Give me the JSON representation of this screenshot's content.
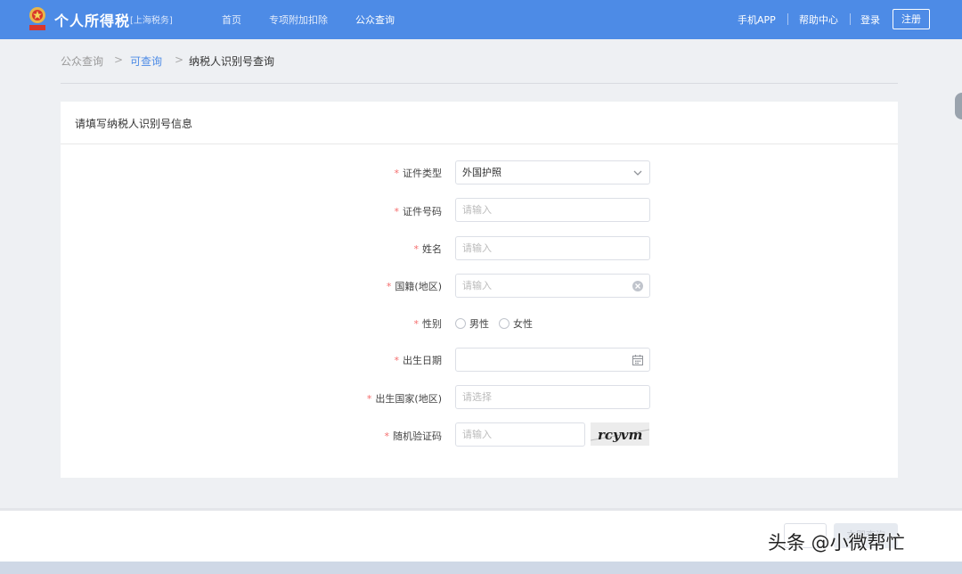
{
  "header": {
    "brand": "个人所得税",
    "region": "[上海税务]",
    "nav": [
      "首页",
      "专项附加扣除",
      "公众查询"
    ],
    "active_nav": "公众查询",
    "links": [
      "手机APP",
      "帮助中心",
      "登录"
    ],
    "register": "注册",
    "colors": {
      "bar": "#4d8be6"
    }
  },
  "breadcrumb": {
    "items": [
      "公众查询",
      "可查询",
      "纳税人识别号查询"
    ],
    "separator": ">"
  },
  "form": {
    "title": "请填写纳税人识别号信息",
    "required_mark": "*",
    "id_type": {
      "label": "证件类型",
      "value": "外国护照"
    },
    "id_number": {
      "label": "证件号码",
      "placeholder": "请输入"
    },
    "name": {
      "label": "姓名",
      "placeholder": "请输入"
    },
    "nationality": {
      "label": "国籍(地区)",
      "placeholder": "请输入"
    },
    "gender": {
      "label": "性别",
      "options": [
        "男性",
        "女性"
      ]
    },
    "birth_date": {
      "label": "出生日期"
    },
    "birth_country": {
      "label": "出生国家(地区)",
      "placeholder": "请选择"
    },
    "captcha": {
      "label": "随机验证码",
      "placeholder": "请输入",
      "image_text": "rcyvm"
    }
  },
  "footer": {
    "query_button": "立即查询"
  },
  "watermark": "头条 @小微帮忙"
}
